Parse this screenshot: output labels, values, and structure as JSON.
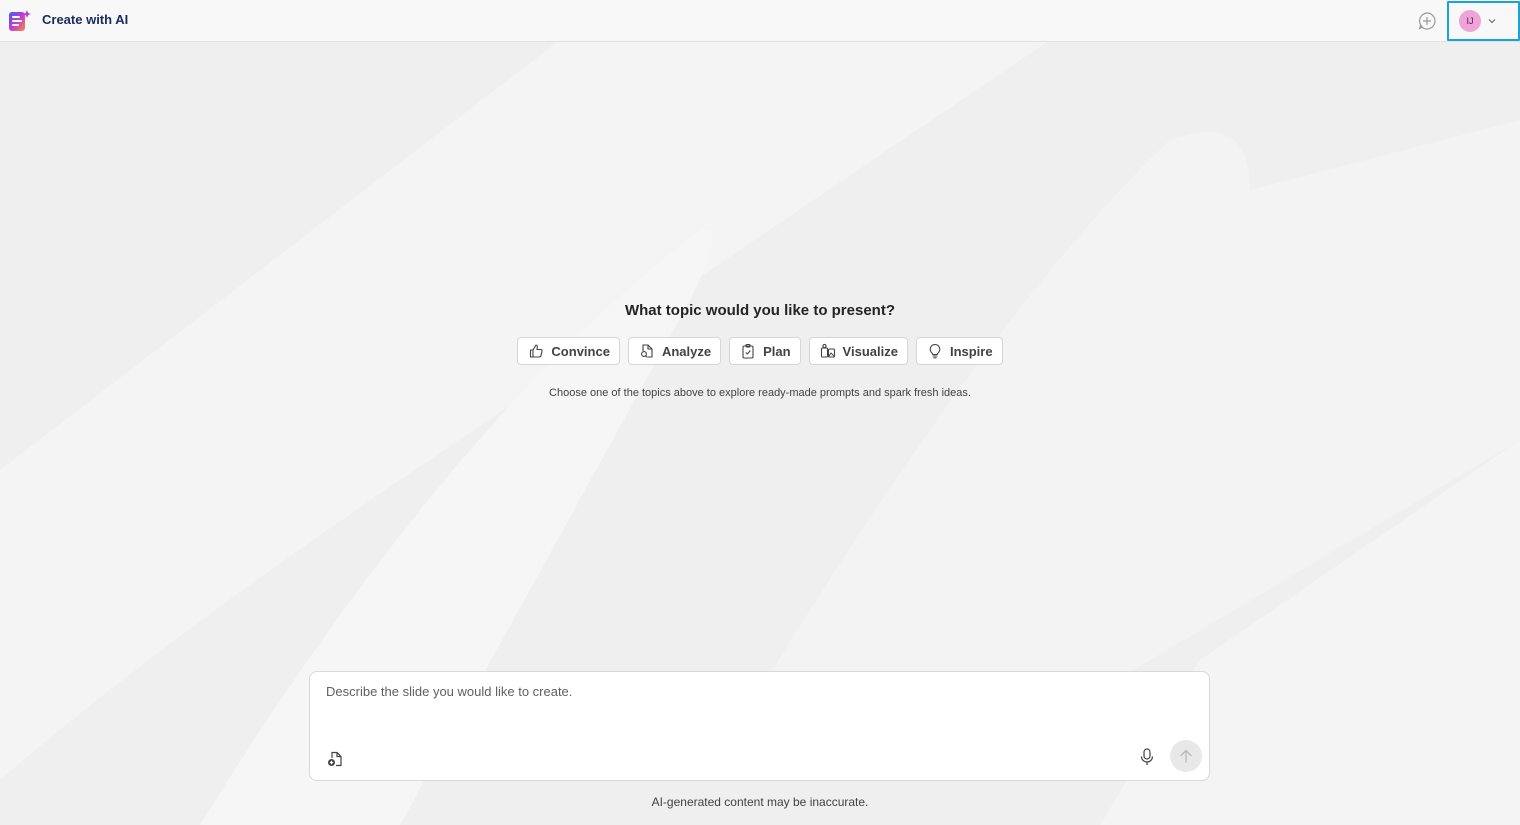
{
  "header": {
    "title": "Create with AI",
    "new_chat_icon": "chat-add-icon",
    "profile": {
      "initials": "IJ",
      "avatar_color": "#f0a3d9",
      "highlight_color": "#1aa3d6"
    }
  },
  "main": {
    "question": "What topic would you like to present?",
    "topics": [
      {
        "label": "Convince",
        "icon": "thumbs-up-icon"
      },
      {
        "label": "Analyze",
        "icon": "document-search-icon"
      },
      {
        "label": "Plan",
        "icon": "clipboard-check-icon"
      },
      {
        "label": "Visualize",
        "icon": "image-shapes-icon"
      },
      {
        "label": "Inspire",
        "icon": "lightbulb-icon"
      }
    ],
    "hint": "Choose one of the topics above to explore ready-made prompts and spark fresh ideas."
  },
  "composer": {
    "placeholder": "Describe the slide you would like to create.",
    "value": "",
    "attach_icon": "attach-file-icon",
    "mic_icon": "microphone-icon",
    "send_icon": "send-arrow-icon"
  },
  "footer": {
    "disclaimer": "AI-generated content may be inaccurate."
  }
}
